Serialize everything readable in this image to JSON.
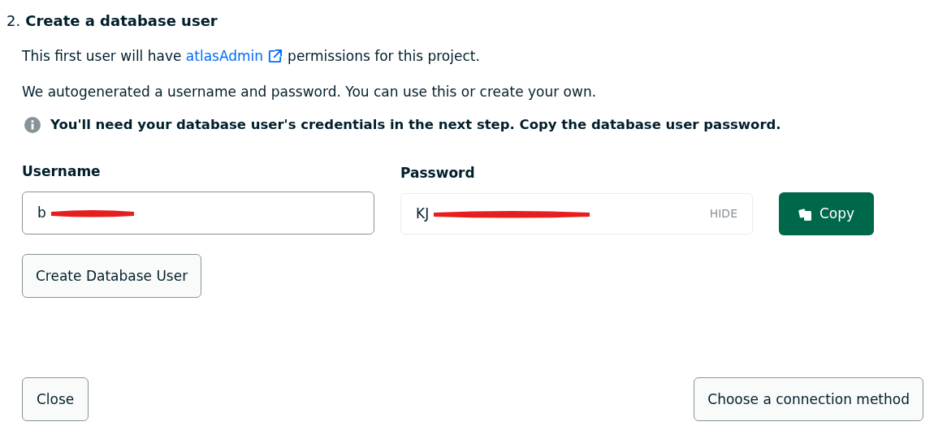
{
  "step": {
    "number": "2.",
    "title": "Create a database user"
  },
  "permissions": {
    "before": "This first user will have",
    "link": "atlasAdmin",
    "after": "permissions for this project."
  },
  "autogen_note": "We autogenerated a username and password. You can use this or create your own.",
  "info_note": "You'll need your database user's credentials in the next step. Copy the database user password.",
  "username": {
    "label": "Username",
    "value": "b",
    "redacted": true
  },
  "password": {
    "label": "Password",
    "value": "KJ",
    "redacted": true,
    "toggle": "HIDE"
  },
  "copy_button": "Copy",
  "create_button": "Create Database User",
  "footer": {
    "close": "Close",
    "next": "Choose a connection method"
  }
}
